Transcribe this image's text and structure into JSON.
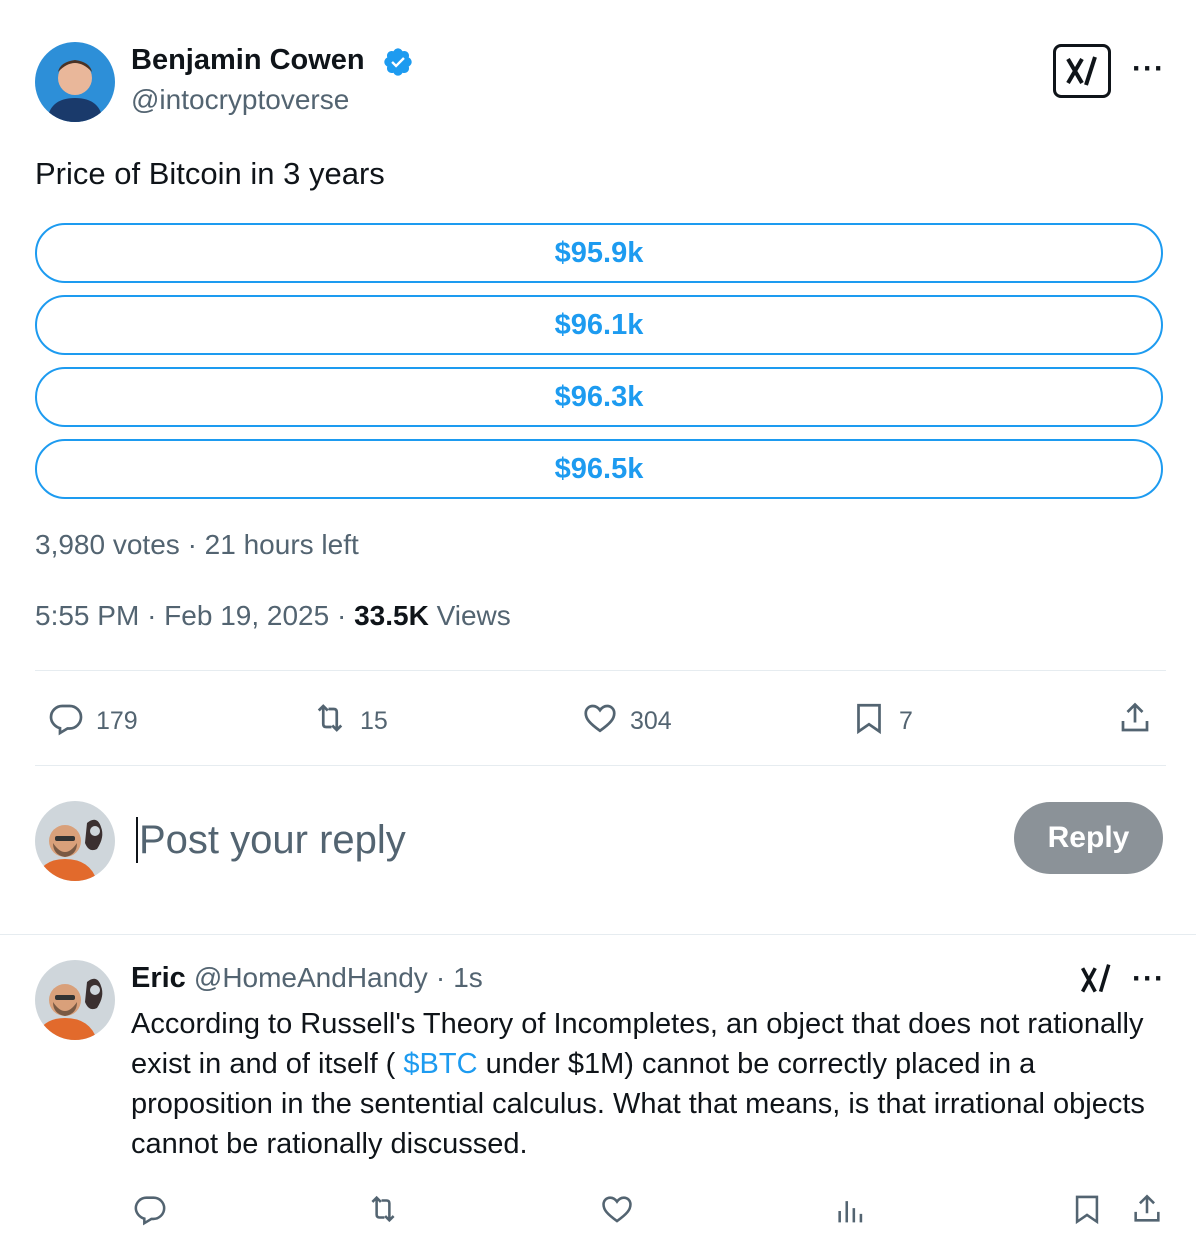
{
  "post": {
    "author_name": "Benjamin Cowen",
    "author_handle": "@intocryptoverse",
    "text": "Price of Bitcoin in 3 years",
    "poll": {
      "options": [
        "$95.9k",
        "$96.1k",
        "$96.3k",
        "$96.5k"
      ],
      "votes": "3,980 votes",
      "time_left": "21 hours left"
    },
    "time": "5:55 PM",
    "date": "Feb 19, 2025",
    "views_count": "33.5K",
    "views_label": "Views",
    "stats": {
      "replies": "179",
      "reposts": "15",
      "likes": "304",
      "bookmarks": "7"
    }
  },
  "composer": {
    "placeholder": "Post your reply",
    "reply_button": "Reply"
  },
  "reply": {
    "author_name": "Eric",
    "author_handle": "@HomeAndHandy",
    "age": "1s",
    "text_part1": "According to Russell's Theory of Incompletes, an object that does not rationally exist in and of itself ( ",
    "cashtag": "$BTC",
    "text_part2": " under $1M) cannot be correctly placed in a proposition in the sentential calculus. What that means, is that irrational objects cannot be rationally discussed."
  },
  "separators": {
    "dot": "·"
  },
  "colors": {
    "accent": "#1d9bf0",
    "text_secondary": "#536471",
    "reply_button_disabled": "#8b9298"
  },
  "icons": {
    "verified": "verified-badge-icon",
    "grok": "grok-icon",
    "more": "more-icon",
    "reply": "reply-icon",
    "repost": "repost-icon",
    "like": "like-icon",
    "bookmark": "bookmark-icon",
    "share": "share-icon",
    "analytics": "analytics-icon"
  }
}
